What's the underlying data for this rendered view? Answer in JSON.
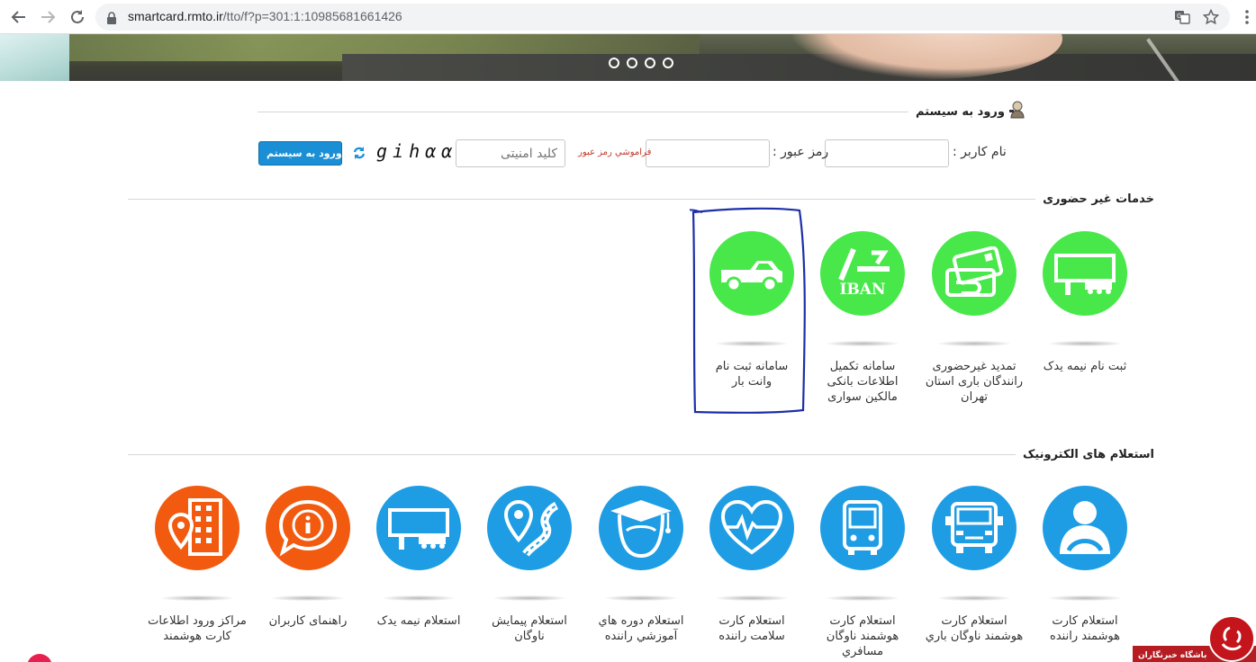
{
  "browser": {
    "url_host": "smartcard.rmto.ir",
    "url_path": "/tto/f?p=301:1:10985681661426"
  },
  "login": {
    "section_title": "ورود به سیستم",
    "username_label": "نام کاربر :",
    "password_label": "رمز عبور :",
    "forgot_label": "فراموشي رمز عبور",
    "security_placeholder": "کلید امنیتی",
    "captcha_text": "gihαα",
    "submit_label": "ورود به سیستم"
  },
  "remote_services": {
    "title": "خدمات غیر حضوری",
    "items": [
      {
        "label": "ثبت نام نیمه یدک",
        "icon": "semi-trailer-icon",
        "color": "#48e84a"
      },
      {
        "label": "تمدید غیرحضوری رانندگان باری استان تهران",
        "icon": "smart-card-icon",
        "color": "#48e84a"
      },
      {
        "label": "سامانه تکمیل اطلاعات بانکی مالکین سواری",
        "icon": "iban-icon",
        "color": "#48e84a",
        "icon_text": "IBAN"
      },
      {
        "label": "سامانه ثبت نام وانت بار",
        "icon": "pickup-truck-icon",
        "color": "#48e84a"
      }
    ]
  },
  "electronic_inquiries": {
    "title": "استعلام های الکترونیک",
    "items": [
      {
        "label": "استعلام کارت هوشمند راننده",
        "icon": "driver-icon",
        "color": "#1e9de4"
      },
      {
        "label": "استعلام کارت هوشمند ناوگان باري",
        "icon": "truck-front-icon",
        "color": "#1e9de4"
      },
      {
        "label": "استعلام کارت هوشمند ناوگان مسافري",
        "icon": "bus-icon",
        "color": "#1e9de4"
      },
      {
        "label": "استعلام کارت سلامت راننده",
        "icon": "heart-pulse-icon",
        "color": "#1e9de4"
      },
      {
        "label": "استعلام دوره هاي آموزشي راننده",
        "icon": "graduate-icon",
        "color": "#1e9de4"
      },
      {
        "label": "استعلام پیمایش ناوگان",
        "icon": "route-pin-icon",
        "color": "#1e9de4"
      },
      {
        "label": "استعلام نیمه یدک",
        "icon": "semi-trailer-icon",
        "color": "#1e9de4"
      },
      {
        "label": "راهنمای کاربران",
        "icon": "info-bubble-icon",
        "color": "#f25a0f"
      },
      {
        "label": "مراکز ورود اطلاعات کارت هوشمند",
        "icon": "building-location-icon",
        "color": "#f25a0f"
      }
    ]
  },
  "watermark": {
    "text": "باشگاه خبرنگاران"
  }
}
